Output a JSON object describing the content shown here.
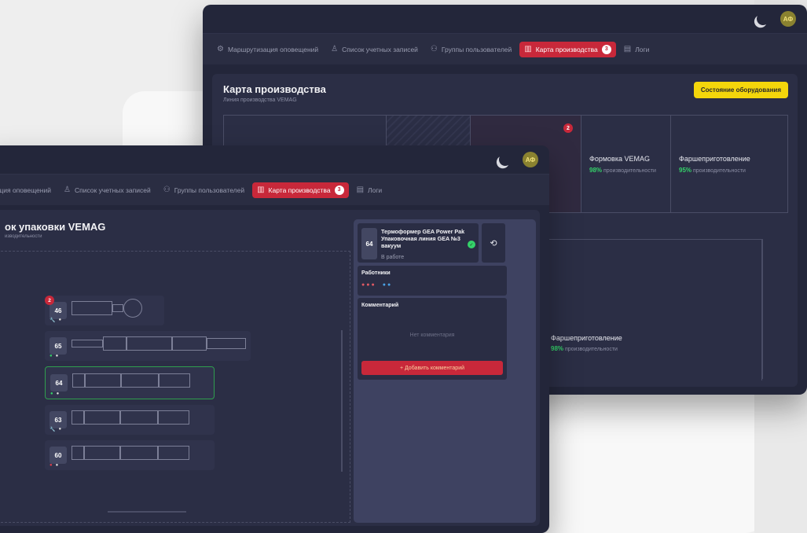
{
  "user": {
    "initials": "АФ"
  },
  "nav": {
    "items": [
      {
        "label": "Маршрутизация оповещений",
        "icon": "routing-icon"
      },
      {
        "label": "Список учетных записей",
        "icon": "user-icon"
      },
      {
        "label": "Группы пользователей",
        "icon": "group-icon"
      },
      {
        "label": "Карта производства",
        "icon": "map-icon",
        "active": true,
        "badge": "3"
      },
      {
        "label": "Логи",
        "icon": "logs-icon"
      }
    ],
    "front_first_label": "изация оповещений"
  },
  "back": {
    "title": "Карта производства",
    "subtitle": "Линия производства VEMAG",
    "equipment_button": "Состояние оборудования",
    "zone_badge": "2",
    "zones": [
      {
        "name": "Формовка VEMAG",
        "percent": "98%",
        "suffix": "производительности"
      },
      {
        "name": "Фаршеприготовление",
        "percent": "95%",
        "suffix": "производительности"
      },
      {
        "name": "Фаршеприготовление",
        "percent": "98%",
        "suffix": "производительности"
      }
    ]
  },
  "front": {
    "title": "ок упаковки VEMAG",
    "subtitle": "изводительности",
    "lines": [
      {
        "num": "46",
        "badge": "2",
        "status": "wrench"
      },
      {
        "num": "65",
        "status": "ok"
      },
      {
        "num": "64",
        "status": "ok",
        "selected": true
      },
      {
        "num": "63",
        "status": "wrench"
      },
      {
        "num": "60",
        "status": "error"
      }
    ],
    "panel": {
      "machine_num": "64",
      "machine_name": "Термоформер GEA Power Pak Упаковочная линия GEA №3 вакуум",
      "machine_status": "В работе",
      "workers_title": "Работники",
      "comments_title": "Комментарий",
      "no_comment": "Нет комментария",
      "add_comment": "+ Добавить комментарий"
    }
  },
  "colors": {
    "accent_red": "#c8283a",
    "accent_yellow": "#f4d60b",
    "ok_green": "#35d36a"
  }
}
